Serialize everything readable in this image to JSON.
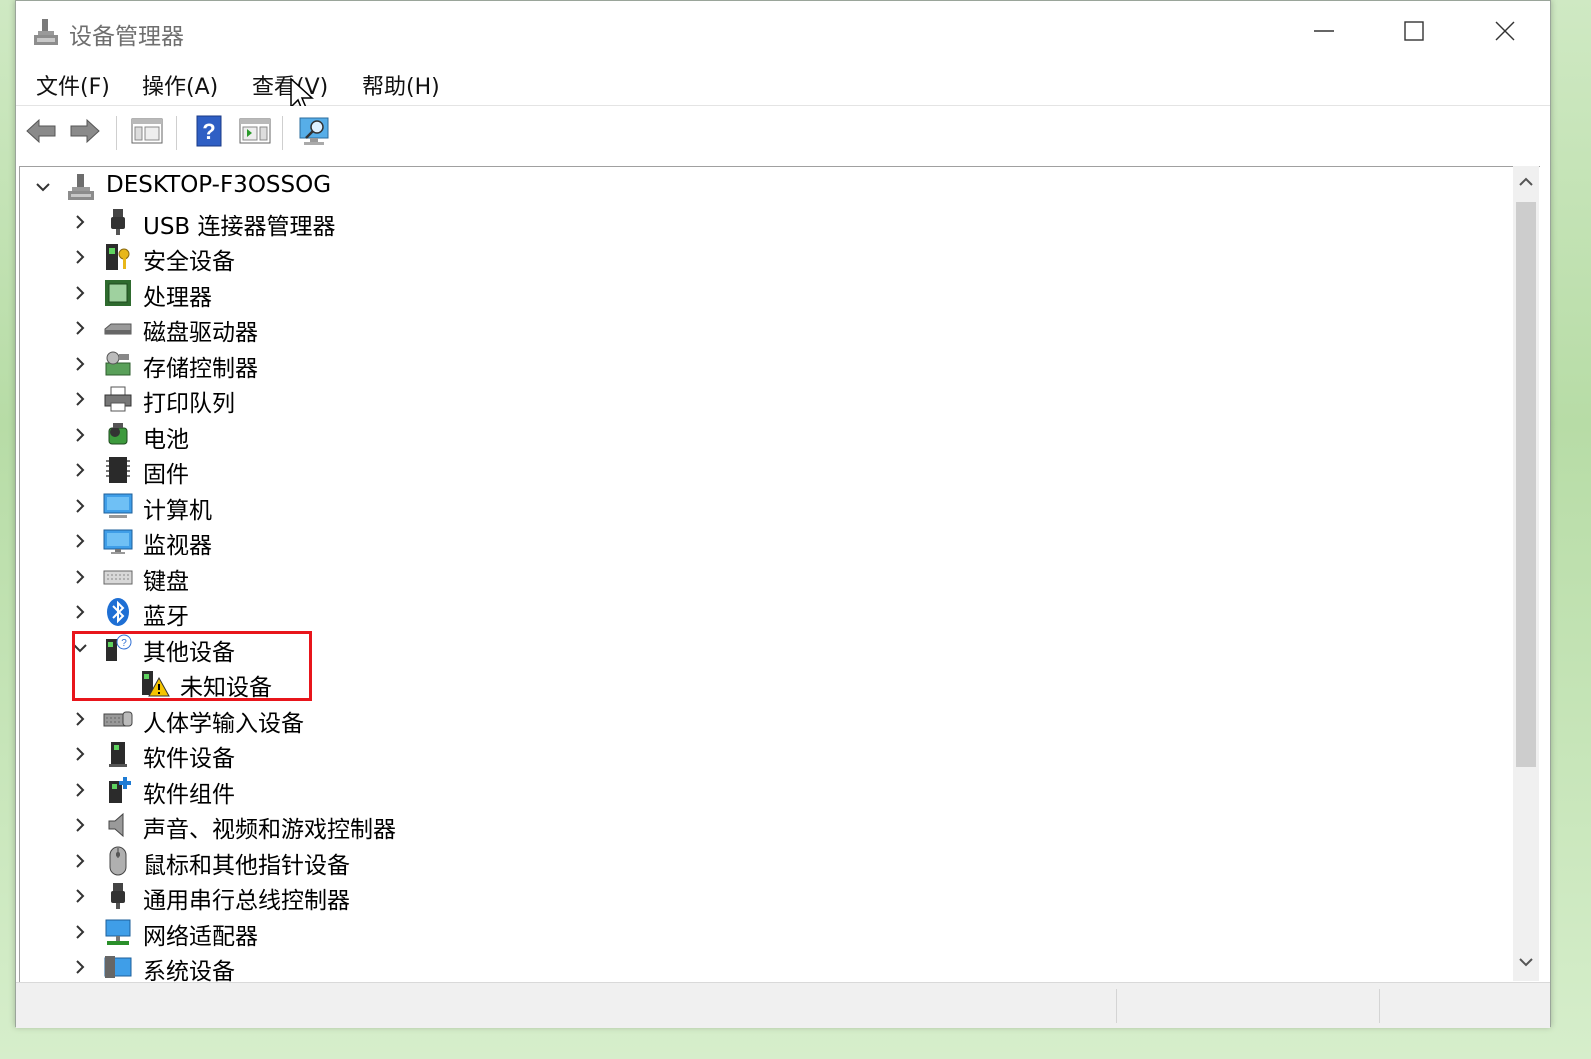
{
  "window": {
    "title": "设备管理器"
  },
  "menu": [
    "文件(F)",
    "操作(A)",
    "查看(V)",
    "帮助(H)"
  ],
  "toolbar": {
    "buttons": [
      "back-icon",
      "forward-icon",
      "show-hide-console-tree-icon",
      "help-icon",
      "action-pane-icon",
      "scan-hardware-icon"
    ]
  },
  "tree": {
    "root": "DESKTOP-F3OSSOG",
    "categories": [
      {
        "label": "USB 连接器管理器",
        "icon": "usb-connector-icon",
        "expanded": false
      },
      {
        "label": "安全设备",
        "icon": "security-device-icon",
        "expanded": false
      },
      {
        "label": "处理器",
        "icon": "processor-icon",
        "expanded": false
      },
      {
        "label": "磁盘驱动器",
        "icon": "disk-drive-icon",
        "expanded": false
      },
      {
        "label": "存储控制器",
        "icon": "storage-controller-icon",
        "expanded": false
      },
      {
        "label": "打印队列",
        "icon": "printer-icon",
        "expanded": false
      },
      {
        "label": "电池",
        "icon": "battery-icon",
        "expanded": false
      },
      {
        "label": "固件",
        "icon": "firmware-icon",
        "expanded": false
      },
      {
        "label": "计算机",
        "icon": "computer-icon",
        "expanded": false
      },
      {
        "label": "监视器",
        "icon": "monitor-icon",
        "expanded": false
      },
      {
        "label": "键盘",
        "icon": "keyboard-icon",
        "expanded": false
      },
      {
        "label": "蓝牙",
        "icon": "bluetooth-icon",
        "expanded": false
      },
      {
        "label": "其他设备",
        "icon": "other-devices-icon",
        "expanded": true,
        "children": [
          {
            "label": "未知设备",
            "icon": "unknown-device-warning-icon"
          }
        ]
      },
      {
        "label": "人体学输入设备",
        "icon": "hid-icon",
        "expanded": false
      },
      {
        "label": "软件设备",
        "icon": "software-device-icon",
        "expanded": false
      },
      {
        "label": "软件组件",
        "icon": "software-component-icon",
        "expanded": false
      },
      {
        "label": "声音、视频和游戏控制器",
        "icon": "sound-icon",
        "expanded": false
      },
      {
        "label": "鼠标和其他指针设备",
        "icon": "mouse-icon",
        "expanded": false
      },
      {
        "label": "通用串行总线控制器",
        "icon": "usb-controller-icon",
        "expanded": false
      },
      {
        "label": "网络适配器",
        "icon": "network-adapter-icon",
        "expanded": false
      },
      {
        "label": "系统设备",
        "icon": "system-devices-icon",
        "expanded": false
      }
    ]
  },
  "colors": {
    "highlight": "#e8151b",
    "accent": "#1e7bd4",
    "warning": "#f5c400"
  }
}
